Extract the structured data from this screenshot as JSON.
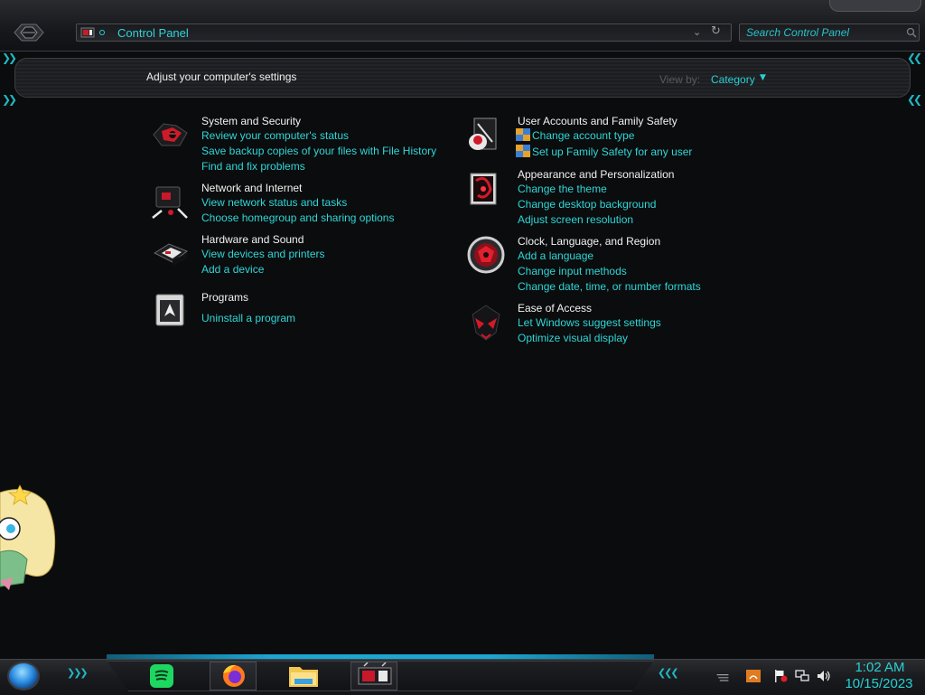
{
  "window": {
    "address": "Control Panel",
    "search_placeholder": "Search Control Panel"
  },
  "header": {
    "title": "Adjust your computer's settings",
    "view_by_label": "View by:",
    "view_by_value": "Category"
  },
  "categories_left": [
    {
      "title": "System and Security",
      "links": [
        "Review your computer's status",
        "Save backup copies of your files with File History",
        "Find and fix problems"
      ]
    },
    {
      "title": "Network and Internet",
      "links": [
        "View network status and tasks",
        "Choose homegroup and sharing options"
      ]
    },
    {
      "title": "Hardware and Sound",
      "links": [
        "View devices and printers",
        "Add a device"
      ]
    },
    {
      "title": "Programs",
      "links": [
        "Uninstall a program"
      ]
    }
  ],
  "categories_right": [
    {
      "title": "User Accounts and Family Safety",
      "links": [
        "Change account type",
        "Set up Family Safety for any user"
      ]
    },
    {
      "title": "Appearance and Personalization",
      "links": [
        "Change the theme",
        "Change desktop background",
        "Adjust screen resolution"
      ]
    },
    {
      "title": "Clock, Language, and Region",
      "links": [
        "Add a language",
        "Change input methods",
        "Change date, time, or number formats"
      ]
    },
    {
      "title": "Ease of Access",
      "links": [
        "Let Windows suggest settings",
        "Optimize visual display"
      ]
    }
  ],
  "taskbar": {
    "apps": [
      "spotify",
      "firefox",
      "file-explorer",
      "control-panel"
    ],
    "time": "1:02 AM",
    "date": "10/15/2023"
  },
  "colors": {
    "accent": "#2fd6d8",
    "icon_red": "#d0202c",
    "background": "#0b0c0d"
  }
}
